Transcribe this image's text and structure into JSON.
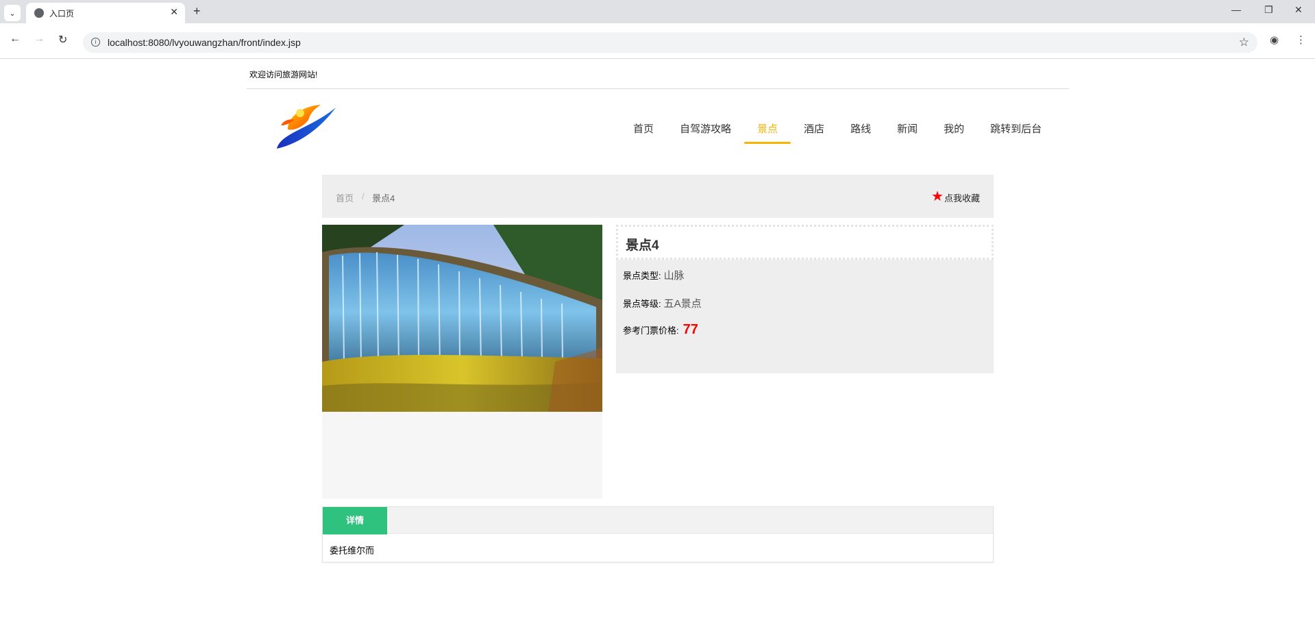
{
  "browser": {
    "tab_title": "入口页",
    "url": "localhost:8080/lvyouwangzhan/front/index.jsp"
  },
  "site": {
    "welcome": "欢迎访问旅游网站!",
    "nav": [
      {
        "label": "首页",
        "active": false
      },
      {
        "label": "自驾游攻略",
        "active": false
      },
      {
        "label": "景点",
        "active": true
      },
      {
        "label": "酒店",
        "active": false
      },
      {
        "label": "路线",
        "active": false
      },
      {
        "label": "新闻",
        "active": false
      },
      {
        "label": "我的",
        "active": false
      },
      {
        "label": "跳转到后台",
        "active": false
      }
    ],
    "accent_color": "#f5b400"
  },
  "breadcrumb": {
    "home": "首页",
    "separator": "/",
    "current": "景点4"
  },
  "favorite": {
    "label": "点我收藏",
    "star_color": "#ff0000"
  },
  "attraction": {
    "name": "景点4",
    "type_label": "景点类型:",
    "type_value": "山脉",
    "level_label": "景点等级:",
    "level_value": "五A景点",
    "price_label": "参考门票价格:",
    "price_value": "77"
  },
  "details": {
    "tab_label": "详情",
    "tab_color": "#2ec27e",
    "content": "委托维尔而"
  }
}
